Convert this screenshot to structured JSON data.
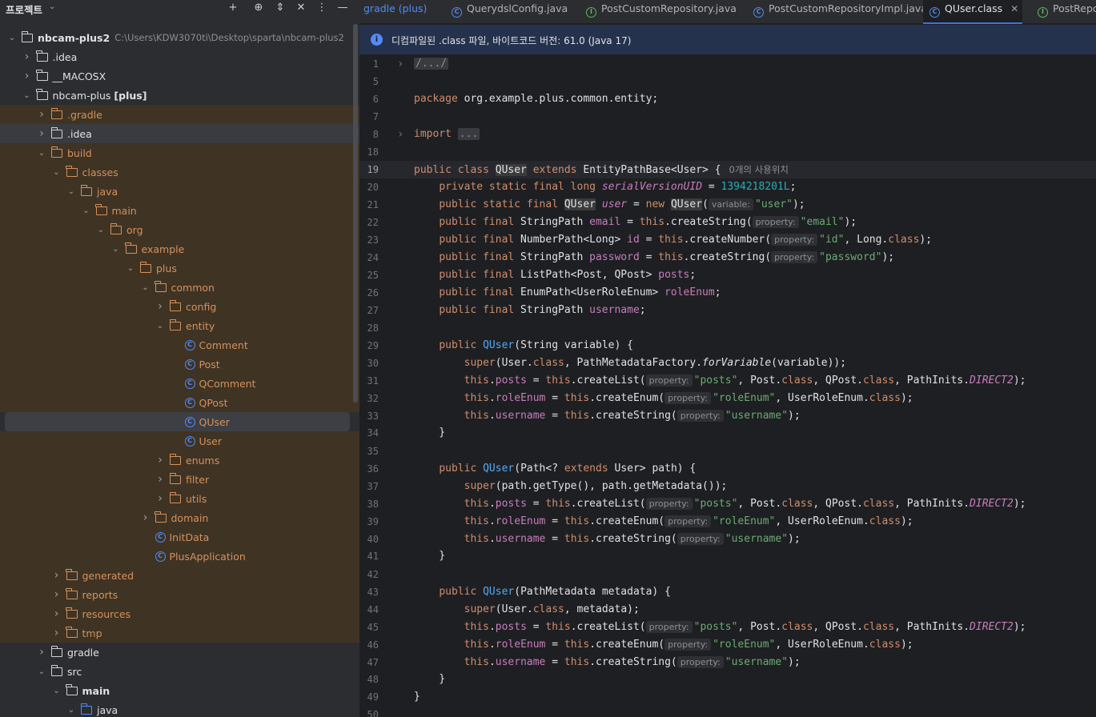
{
  "project_panel": {
    "title": "프로젝트",
    "tree": [
      {
        "label": "nbcam-plus2",
        "path": "C:\\Users\\KDW3070ti\\Desktop\\sparta\\nbcam-plus2",
        "depth": 0,
        "chevron": "down",
        "icon": "module-folder",
        "bold": true
      },
      {
        "label": ".idea",
        "depth": 1,
        "chevron": "right",
        "icon": "folder"
      },
      {
        "label": "__MACOSX",
        "depth": 1,
        "chevron": "right",
        "icon": "folder"
      },
      {
        "label": "nbcam-plus",
        "suffix": "[plus]",
        "depth": 1,
        "chevron": "down",
        "icon": "module-folder"
      },
      {
        "label": ".gradle",
        "depth": 2,
        "chevron": "right",
        "icon": "folder-excluded",
        "excluded": true
      },
      {
        "label": ".idea",
        "depth": 2,
        "chevron": "right",
        "icon": "folder",
        "highlight": "gray"
      },
      {
        "label": "build",
        "depth": 2,
        "chevron": "down",
        "icon": "folder-excluded",
        "excluded": true
      },
      {
        "label": "classes",
        "depth": 3,
        "chevron": "down",
        "icon": "folder-excluded",
        "excluded": true
      },
      {
        "label": "java",
        "depth": 4,
        "chevron": "down",
        "icon": "folder-excluded",
        "excluded": true
      },
      {
        "label": "main",
        "depth": 5,
        "chevron": "down",
        "icon": "folder-excluded",
        "excluded": true
      },
      {
        "label": "org",
        "depth": 6,
        "chevron": "down",
        "icon": "folder-excluded",
        "excluded": true
      },
      {
        "label": "example",
        "depth": 7,
        "chevron": "down",
        "icon": "folder-excluded",
        "excluded": true
      },
      {
        "label": "plus",
        "depth": 8,
        "chevron": "down",
        "icon": "folder-excluded",
        "excluded": true
      },
      {
        "label": "common",
        "depth": 9,
        "chevron": "down",
        "icon": "folder-excluded",
        "excluded": true
      },
      {
        "label": "config",
        "depth": 10,
        "chevron": "right",
        "icon": "folder-excluded",
        "excluded": true
      },
      {
        "label": "entity",
        "depth": 10,
        "chevron": "down",
        "icon": "folder-excluded",
        "excluded": true
      },
      {
        "label": "Comment",
        "depth": 11,
        "chevron": "none",
        "icon": "class",
        "excluded": true
      },
      {
        "label": "Post",
        "depth": 11,
        "chevron": "none",
        "icon": "class",
        "excluded": true
      },
      {
        "label": "QComment",
        "depth": 11,
        "chevron": "none",
        "icon": "class",
        "excluded": true
      },
      {
        "label": "QPost",
        "depth": 11,
        "chevron": "none",
        "icon": "class",
        "excluded": true
      },
      {
        "label": "QUser",
        "depth": 11,
        "chevron": "none",
        "icon": "class",
        "excluded": true,
        "selected": true
      },
      {
        "label": "User",
        "depth": 11,
        "chevron": "none",
        "icon": "class",
        "excluded": true
      },
      {
        "label": "enums",
        "depth": 10,
        "chevron": "right",
        "icon": "folder-excluded",
        "excluded": true
      },
      {
        "label": "filter",
        "depth": 10,
        "chevron": "right",
        "icon": "folder-excluded",
        "excluded": true
      },
      {
        "label": "utils",
        "depth": 10,
        "chevron": "right",
        "icon": "folder-excluded",
        "excluded": true
      },
      {
        "label": "domain",
        "depth": 9,
        "chevron": "right",
        "icon": "folder-excluded",
        "excluded": true
      },
      {
        "label": "InitData",
        "depth": 9,
        "chevron": "none",
        "icon": "class",
        "excluded": true
      },
      {
        "label": "PlusApplication",
        "depth": 9,
        "chevron": "none",
        "icon": "app-class",
        "excluded": true
      },
      {
        "label": "generated",
        "depth": 3,
        "chevron": "right",
        "icon": "folder-excluded",
        "excluded": true
      },
      {
        "label": "reports",
        "depth": 3,
        "chevron": "right",
        "icon": "folder-excluded",
        "excluded": true
      },
      {
        "label": "resources",
        "depth": 3,
        "chevron": "right",
        "icon": "folder-excluded",
        "excluded": true
      },
      {
        "label": "tmp",
        "depth": 3,
        "chevron": "right",
        "icon": "folder-excluded",
        "excluded": true
      },
      {
        "label": "gradle",
        "depth": 2,
        "chevron": "right",
        "icon": "folder"
      },
      {
        "label": "src",
        "depth": 2,
        "chevron": "down",
        "icon": "folder"
      },
      {
        "label": "main",
        "depth": 3,
        "chevron": "down",
        "icon": "module-folder",
        "bold": true
      },
      {
        "label": "java",
        "depth": 4,
        "chevron": "down",
        "icon": "source-folder"
      }
    ]
  },
  "tabs": [
    {
      "label": "gradle (plus)",
      "icon": "none",
      "color": "#548af7"
    },
    {
      "label": "QuerydslConfig.java",
      "icon": "class"
    },
    {
      "label": "PostCustomRepository.java",
      "icon": "interface"
    },
    {
      "label": "PostCustomRepositoryImpl.java",
      "icon": "class"
    },
    {
      "label": "QUser.class",
      "icon": "class",
      "active": true
    },
    {
      "label": "PostRepo",
      "icon": "interface"
    }
  ],
  "banner": {
    "text": "디컴파일된 .class 파일, 바이트코드 버전: 61.0 (Java 17)"
  },
  "code_lines": [
    {
      "n": "1",
      "fold": "›",
      "html": "<span class=\"collapsed\">/.../</span>"
    },
    {
      "n": "5",
      "html": ""
    },
    {
      "n": "6",
      "html": "<span class=\"kw\">package</span> org.example.plus.common.entity;"
    },
    {
      "n": "7",
      "html": ""
    },
    {
      "n": "8",
      "fold": "›",
      "html": "<span class=\"kw\">import</span> <span class=\"collapsed\">...</span>"
    },
    {
      "n": "18",
      "html": ""
    },
    {
      "n": "19",
      "cur": true,
      "html": "<span class=\"kw\">public class</span> <span class=\"hl\">QUser</span> <span class=\"kw\">extends</span> EntityPathBase&lt;User&gt; {<span class=\"usage\">0개의 사용위치</span>"
    },
    {
      "n": "20",
      "html": "    <span class=\"kw\">private static final long</span> <span class=\"sfld\">serialVersionUID</span> = <span class=\"num\">1394218201L</span>;"
    },
    {
      "n": "21",
      "html": "    <span class=\"kw\">public static final</span> <span class=\"hl\">QUser</span> <span class=\"sfld\">user</span> = <span class=\"kw\">new</span> <span class=\"hl\">QUser</span>(<span class=\"hint\">variable:</span><span class=\"str\">\"user\"</span>);"
    },
    {
      "n": "22",
      "html": "    <span class=\"kw\">public final</span> StringPath <span class=\"fld\">email</span> = <span class=\"kw\">this</span>.createString(<span class=\"hint\">property:</span><span class=\"str\">\"email\"</span>);"
    },
    {
      "n": "23",
      "html": "    <span class=\"kw\">public final</span> NumberPath&lt;Long&gt; <span class=\"fld\">id</span> = <span class=\"kw\">this</span>.createNumber(<span class=\"hint\">property:</span><span class=\"str\">\"id\"</span>, Long.<span class=\"kw\">class</span>);"
    },
    {
      "n": "24",
      "html": "    <span class=\"kw\">public final</span> StringPath <span class=\"fld\">password</span> = <span class=\"kw\">this</span>.createString(<span class=\"hint\">property:</span><span class=\"str\">\"password\"</span>);"
    },
    {
      "n": "25",
      "html": "    <span class=\"kw\">public final</span> ListPath&lt;Post, QPost&gt; <span class=\"fld\">posts</span>;"
    },
    {
      "n": "26",
      "html": "    <span class=\"kw\">public final</span> EnumPath&lt;UserRoleEnum&gt; <span class=\"fld\">roleEnum</span>;"
    },
    {
      "n": "27",
      "html": "    <span class=\"kw\">public final</span> StringPath <span class=\"fld\">username</span>;"
    },
    {
      "n": "28",
      "html": ""
    },
    {
      "n": "29",
      "html": "    <span class=\"kw\">public</span> <span class=\"fn\">QUser</span>(String variable) {"
    },
    {
      "n": "30",
      "html": "        <span class=\"kw\">super</span>(User.<span class=\"kw\">class</span>, PathMetadataFactory.<span class=\"it\">forVariable</span>(variable));"
    },
    {
      "n": "31",
      "html": "        <span class=\"kw\">this</span>.<span class=\"fld\">posts</span> = <span class=\"kw\">this</span>.createList(<span class=\"hint\">property:</span><span class=\"str\">\"posts\"</span>, Post.<span class=\"kw\">class</span>, QPost.<span class=\"kw\">class</span>, PathInits.<span class=\"sfld\">DIRECT2</span>);"
    },
    {
      "n": "32",
      "html": "        <span class=\"kw\">this</span>.<span class=\"fld\">roleEnum</span> = <span class=\"kw\">this</span>.createEnum(<span class=\"hint\">property:</span><span class=\"str\">\"roleEnum\"</span>, UserRoleEnum.<span class=\"kw\">class</span>);"
    },
    {
      "n": "33",
      "html": "        <span class=\"kw\">this</span>.<span class=\"fld\">username</span> = <span class=\"kw\">this</span>.createString(<span class=\"hint\">property:</span><span class=\"str\">\"username\"</span>);"
    },
    {
      "n": "34",
      "html": "    }"
    },
    {
      "n": "35",
      "html": ""
    },
    {
      "n": "36",
      "html": "    <span class=\"kw\">public</span> <span class=\"fn\">QUser</span>(Path&lt;? <span class=\"kw\">extends</span> User&gt; path) {"
    },
    {
      "n": "37",
      "html": "        <span class=\"kw\">super</span>(path.getType(), path.getMetadata());"
    },
    {
      "n": "38",
      "html": "        <span class=\"kw\">this</span>.<span class=\"fld\">posts</span> = <span class=\"kw\">this</span>.createList(<span class=\"hint\">property:</span><span class=\"str\">\"posts\"</span>, Post.<span class=\"kw\">class</span>, QPost.<span class=\"kw\">class</span>, PathInits.<span class=\"sfld\">DIRECT2</span>);"
    },
    {
      "n": "39",
      "html": "        <span class=\"kw\">this</span>.<span class=\"fld\">roleEnum</span> = <span class=\"kw\">this</span>.createEnum(<span class=\"hint\">property:</span><span class=\"str\">\"roleEnum\"</span>, UserRoleEnum.<span class=\"kw\">class</span>);"
    },
    {
      "n": "40",
      "html": "        <span class=\"kw\">this</span>.<span class=\"fld\">username</span> = <span class=\"kw\">this</span>.createString(<span class=\"hint\">property:</span><span class=\"str\">\"username\"</span>);"
    },
    {
      "n": "41",
      "html": "    }"
    },
    {
      "n": "42",
      "html": ""
    },
    {
      "n": "43",
      "html": "    <span class=\"kw\">public</span> <span class=\"fn\">QUser</span>(PathMetadata metadata) {"
    },
    {
      "n": "44",
      "html": "        <span class=\"kw\">super</span>(User.<span class=\"kw\">class</span>, metadata);"
    },
    {
      "n": "45",
      "html": "        <span class=\"kw\">this</span>.<span class=\"fld\">posts</span> = <span class=\"kw\">this</span>.createList(<span class=\"hint\">property:</span><span class=\"str\">\"posts\"</span>, Post.<span class=\"kw\">class</span>, QPost.<span class=\"kw\">class</span>, PathInits.<span class=\"sfld\">DIRECT2</span>);"
    },
    {
      "n": "46",
      "html": "        <span class=\"kw\">this</span>.<span class=\"fld\">roleEnum</span> = <span class=\"kw\">this</span>.createEnum(<span class=\"hint\">property:</span><span class=\"str\">\"roleEnum\"</span>, UserRoleEnum.<span class=\"kw\">class</span>);"
    },
    {
      "n": "47",
      "html": "        <span class=\"kw\">this</span>.<span class=\"fld\">username</span> = <span class=\"kw\">this</span>.createString(<span class=\"hint\">property:</span><span class=\"str\">\"username\"</span>);"
    },
    {
      "n": "48",
      "html": "    }"
    },
    {
      "n": "49",
      "html": "}"
    },
    {
      "n": "50",
      "html": ""
    }
  ],
  "colors": {
    "accent": "#3574f0",
    "excluded_folder": "#d5925b",
    "excluded_row": "#3f3324",
    "class_icon": "#548af7"
  }
}
